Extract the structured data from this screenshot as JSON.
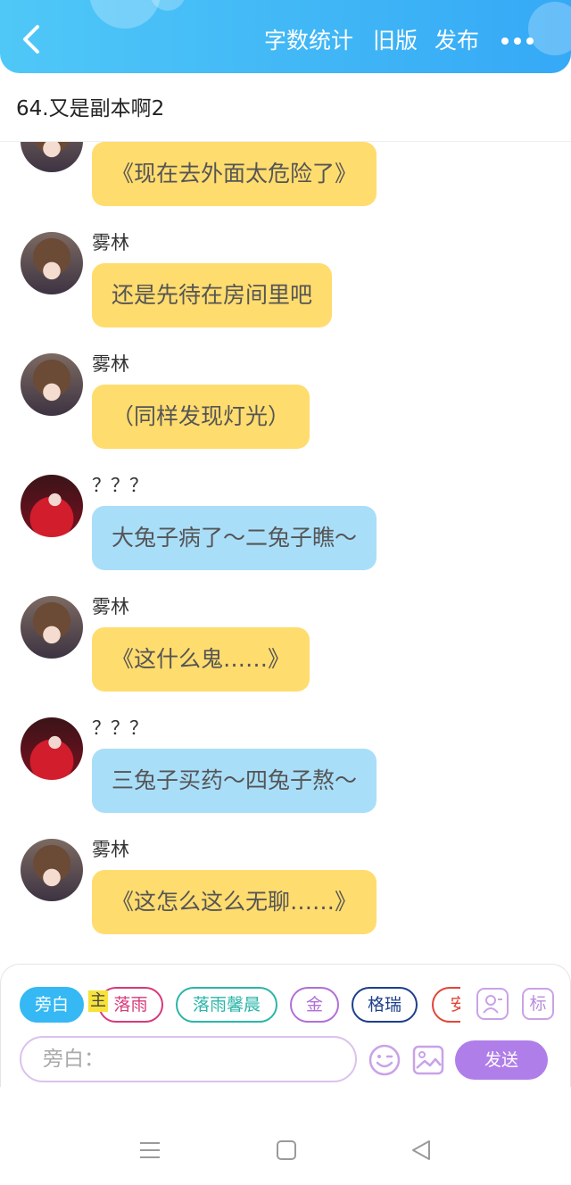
{
  "header": {
    "back_icon": "chevron-left-icon",
    "word_count": "字数统计",
    "old_version": "旧版",
    "publish": "发布",
    "more_icon": "more-dots-icon",
    "color": "#35a9f6"
  },
  "chapter": {
    "title": "64.又是副本啊2"
  },
  "messages": [
    {
      "sender": "",
      "avatar": "girl-avatar",
      "text": "《现在去外面太危险了》",
      "color": "yellow"
    },
    {
      "sender": "雾林",
      "avatar": "girl-avatar",
      "text": "还是先待在房间里吧",
      "color": "yellow"
    },
    {
      "sender": "雾林",
      "avatar": "girl-avatar",
      "text": "（同样发现灯光）",
      "color": "yellow"
    },
    {
      "sender": "？？？",
      "avatar": "red-dress-avatar",
      "text": "大兔子病了～二兔子瞧～",
      "color": "blue"
    },
    {
      "sender": "雾林",
      "avatar": "girl-avatar",
      "text": "《这什么鬼……》",
      "color": "yellow"
    },
    {
      "sender": "？？？",
      "avatar": "red-dress-avatar",
      "text": "三兔子买药～四兔子熬～",
      "color": "blue"
    },
    {
      "sender": "雾林",
      "avatar": "girl-avatar",
      "text": "《这怎么这么无聊……》",
      "color": "yellow"
    }
  ],
  "roles": [
    {
      "label": "旁白",
      "color": "#35b8f4",
      "selected": true
    },
    {
      "label": "落雨",
      "color": "#d6397a",
      "selected": false
    },
    {
      "label": "落雨馨晨",
      "color": "#2bb5a8",
      "selected": false
    },
    {
      "label": "金",
      "color": "#b070d8",
      "selected": false
    },
    {
      "label": "格瑞",
      "color": "#1d3f8a",
      "selected": false
    },
    {
      "label": "安",
      "color": "#e0463a",
      "selected": false
    }
  ],
  "host_tag": "主",
  "toolbar": {
    "role_icon": "role-card-icon",
    "mark_label": "标",
    "input_placeholder": "旁白：",
    "emoji_icon": "emoji-icon",
    "image_icon": "image-icon",
    "send_label": "发送"
  },
  "navbar": {
    "menu_icon": "menu-icon",
    "home_icon": "home-icon",
    "back_icon": "back-triangle-icon"
  }
}
